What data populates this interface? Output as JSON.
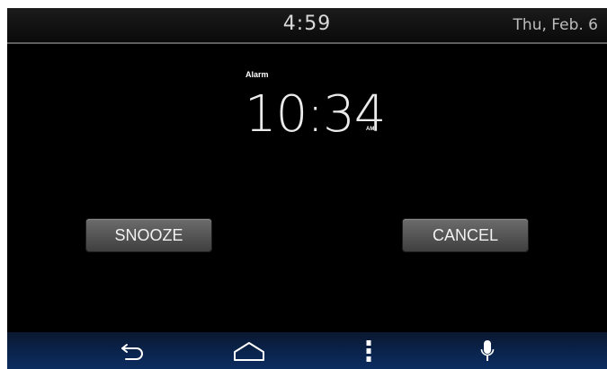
{
  "status_bar": {
    "time": "4:59",
    "date": "Thu, Feb. 6"
  },
  "alarm": {
    "label": "Alarm",
    "time": "10:34",
    "ampm": "AM"
  },
  "buttons": {
    "snooze_label": "SNOOZE",
    "cancel_label": "CANCEL"
  },
  "nav_bar": {
    "items": [
      {
        "icon": "back-icon"
      },
      {
        "icon": "home-icon"
      },
      {
        "icon": "menu-icon"
      },
      {
        "icon": "microphone-icon"
      }
    ]
  },
  "colors": {
    "background": "#000000",
    "button": "#5a5a5a",
    "nav_bar": "#0a2550",
    "text": "#ffffff"
  }
}
